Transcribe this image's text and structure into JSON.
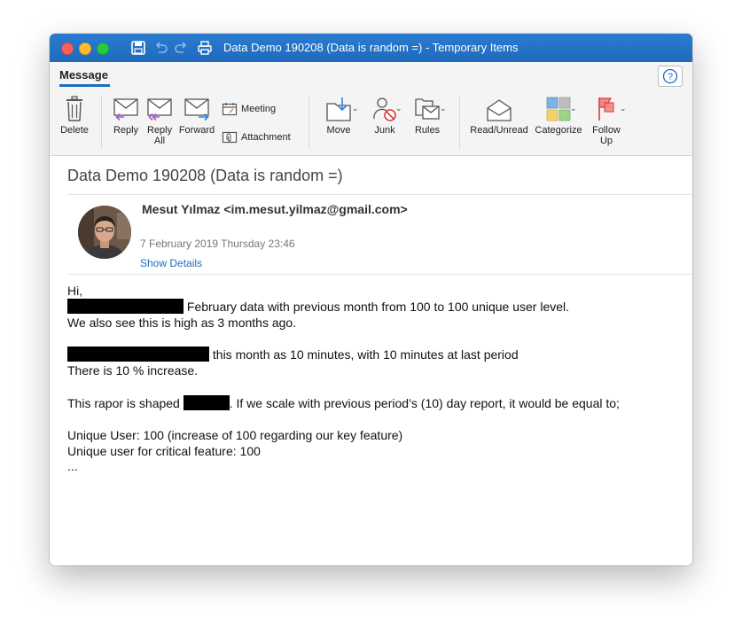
{
  "window": {
    "title": "Data Demo 190208 (Data is random =) - Temporary Items"
  },
  "ribbon": {
    "tab": "Message",
    "buttons": {
      "delete": "Delete",
      "reply": "Reply",
      "reply_all": "Reply All",
      "forward": "Forward",
      "meeting": "Meeting",
      "attachment": "Attachment",
      "move": "Move",
      "junk": "Junk",
      "rules": "Rules",
      "read_unread": "Read/Unread",
      "categorize": "Categorize",
      "follow_up": "Follow Up"
    },
    "help_icon": "question-icon"
  },
  "message": {
    "subject": "Data Demo 190208 (Data is random =)",
    "sender": "Mesut Yılmaz <im.mesut.yilmaz@gmail.com>",
    "date": "7 February 2019 Thursday 23:46",
    "show_details": "Show Details",
    "body": {
      "greeting": "Hi,",
      "line1": " February data with previous month from 100 to 100 unique user level.",
      "line2": "We also see this is high as 3 months ago.",
      "line3": " this month as 10 minutes, with 10 minutes at last period",
      "line4": "There is 10 % increase.",
      "line5a": "This rapor is shaped ",
      "line5b": ". If we scale with previous period’s (10) day report, it would be equal to;",
      "line6": "Unique User: 100 (increase of 100 regarding our key feature)",
      "line7": "Unique user for critical feature: 100",
      "line8": "..."
    }
  },
  "colors": {
    "titlebar": "#1f6bbd",
    "accent": "#1f6bbd",
    "redaction": "#000000"
  }
}
